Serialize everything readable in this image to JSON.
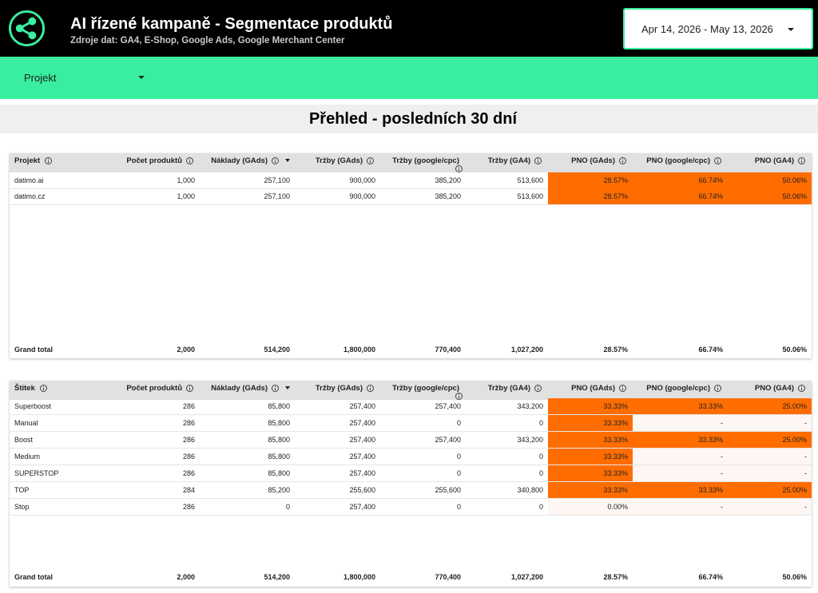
{
  "header": {
    "title": "AI řízené kampaně - Segmentace produktů",
    "subtitle": "Zdroje dat: GA4, E-Shop, Google Ads, Google Merchant Center",
    "logo_icon": "share-icon",
    "date_range": "Apr 14, 2026 - May 13, 2026"
  },
  "filter": {
    "label": "Projekt"
  },
  "section": {
    "title": "Přehled - posledních 30 dní"
  },
  "colors": {
    "header_bg": "#000000",
    "accent_green": "#39ef9f",
    "highlight_orange": "#ff6d01"
  },
  "table1": {
    "columns": [
      "Projekt",
      "Počet produktů",
      "Náklady (GAds)",
      "Tržby (GAds)",
      "Tržby (google/cpc)",
      "Tržby (GA4)",
      "PNO (GAds)",
      "PNO (google/cpc)",
      "PNO (GA4)"
    ],
    "sorted_column": "Náklady (GAds)",
    "rows": [
      [
        "datimo.ai",
        "1,000",
        "257,100",
        "900,000",
        "385,200",
        "513,600",
        "28.57%",
        "66.74%",
        "50.06%"
      ],
      [
        "datimo.cz",
        "1,000",
        "257,100",
        "900,000",
        "385,200",
        "513,600",
        "28.57%",
        "66.74%",
        "50.06%"
      ]
    ],
    "total": [
      "Grand total",
      "2,000",
      "514,200",
      "1,800,000",
      "770,400",
      "1,027,200",
      "28.57%",
      "66.74%",
      "50.06%"
    ]
  },
  "table2": {
    "columns": [
      "Štítek",
      "Počet produktů",
      "Náklady (GAds)",
      "Tržby (GAds)",
      "Tržby (google/cpc)",
      "Tržby (GA4)",
      "PNO (GAds)",
      "PNO (google/cpc)",
      "PNO (GA4)"
    ],
    "sorted_column": "Náklady (GAds)",
    "rows": [
      [
        "Superboost",
        "286",
        "85,800",
        "257,400",
        "257,400",
        "343,200",
        "33.33%",
        "33.33%",
        "25.00%"
      ],
      [
        "Manual",
        "286",
        "85,800",
        "257,400",
        "0",
        "0",
        "33.33%",
        "-",
        "-"
      ],
      [
        "Boost",
        "286",
        "85,800",
        "257,400",
        "257,400",
        "343,200",
        "33.33%",
        "33.33%",
        "25.00%"
      ],
      [
        "Medium",
        "286",
        "85,800",
        "257,400",
        "0",
        "0",
        "33.33%",
        "-",
        "-"
      ],
      [
        "SUPERSTOP",
        "286",
        "85,800",
        "257,400",
        "0",
        "0",
        "33.33%",
        "-",
        "-"
      ],
      [
        "TOP",
        "284",
        "85,200",
        "255,600",
        "255,600",
        "340,800",
        "33.33%",
        "33.33%",
        "25.00%"
      ],
      [
        "Stop",
        "286",
        "0",
        "257,400",
        "0",
        "0",
        "0.00%",
        "-",
        "-"
      ]
    ],
    "total": [
      "Grand total",
      "2,000",
      "514,200",
      "1,800,000",
      "770,400",
      "1,027,200",
      "28.57%",
      "66.74%",
      "50.06%"
    ]
  }
}
